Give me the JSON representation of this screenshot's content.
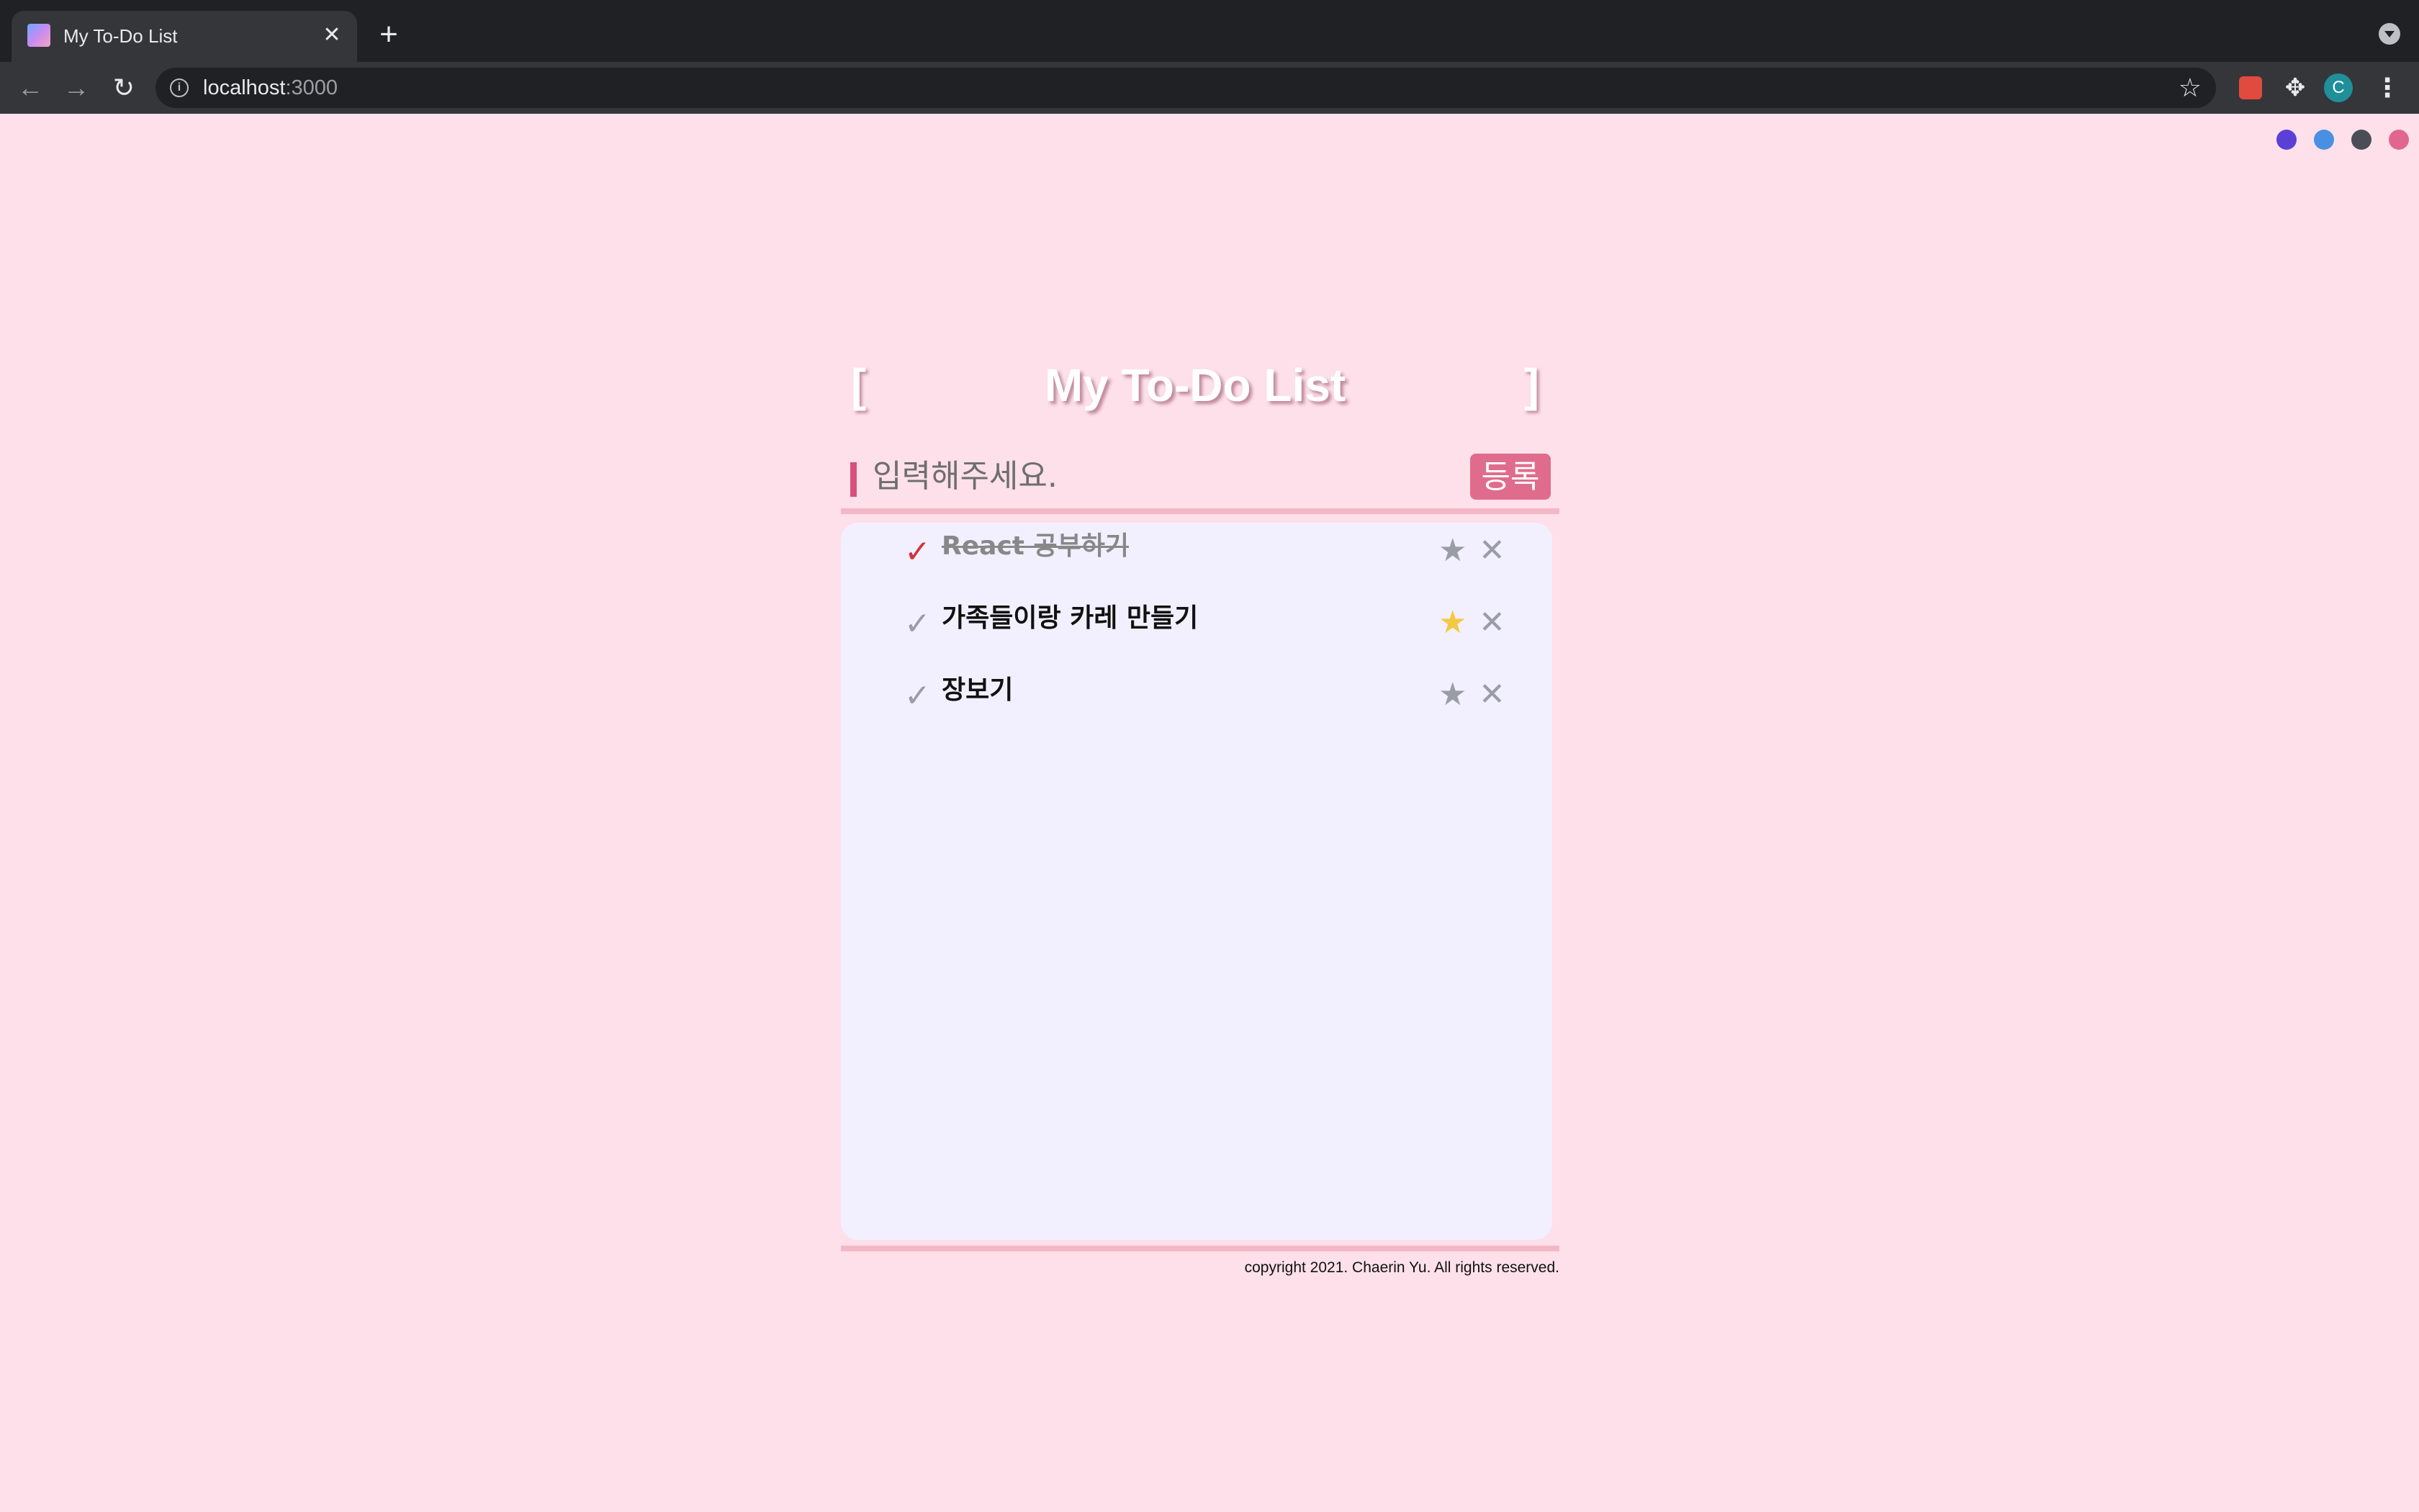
{
  "browser": {
    "tab_title": "My To-Do List",
    "tab_close": "✕",
    "new_tab": "+",
    "url_host": "localhost",
    "url_port": ":3000",
    "avatar_letter": "C",
    "icons": {
      "back": "arrow-left-icon",
      "forward": "arrow-right-icon",
      "reload": "reload-icon",
      "info": "info-icon",
      "bookmark": "star-outline-icon",
      "extension": "puzzle-icon",
      "menu": "kebab-menu-icon"
    }
  },
  "theme_picker": {
    "colors": [
      "#5b3fd6",
      "#4a90e2",
      "#4a4d55",
      "#e0668f"
    ]
  },
  "app": {
    "bracket_left": "[",
    "title": "My To-Do List",
    "bracket_right": "]",
    "input_placeholder": "입력해주세요.",
    "input_value": "",
    "add_button_label": "등록",
    "todos": [
      {
        "text": "React 공부하기",
        "completed": true,
        "starred": false
      },
      {
        "text": "가족들이랑 카레 만들기",
        "completed": false,
        "starred": true
      },
      {
        "text": "장보기",
        "completed": false,
        "starred": false
      }
    ],
    "copyright": "copyright 2021. Chaerin Yu. All rights reserved."
  },
  "colors": {
    "background": "#fde0ea",
    "panel": "#f2f0ff",
    "accent": "#e06c8d",
    "check_done": "#d0343f",
    "check_idle": "#9a9ca6",
    "star_on": "#f5c842",
    "star_off": "#9a9ca6"
  }
}
